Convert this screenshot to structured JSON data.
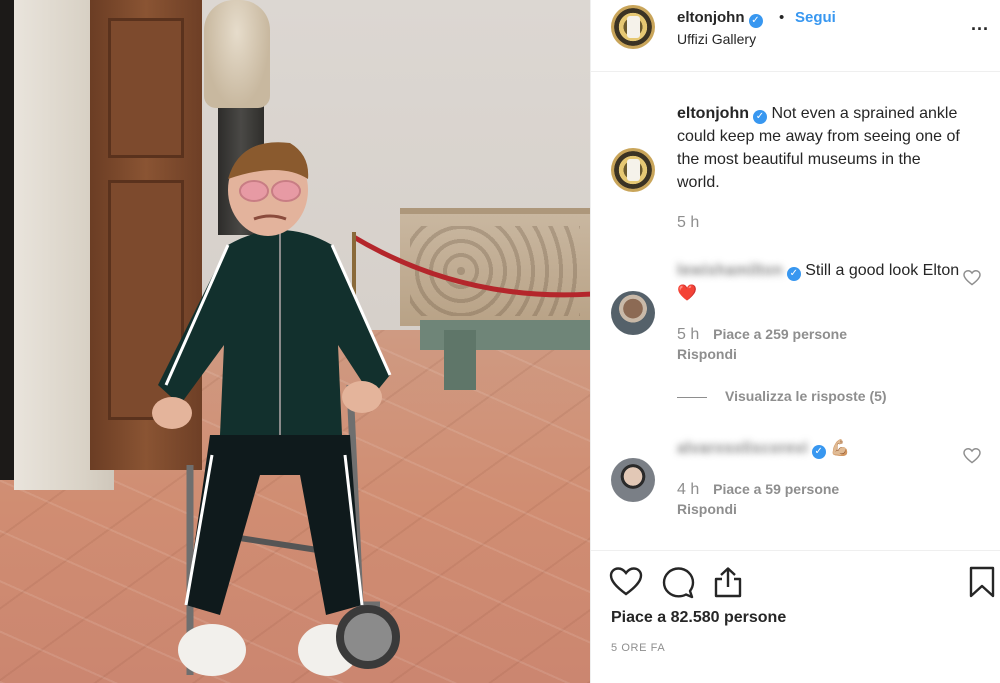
{
  "header": {
    "username": "eltonjohn",
    "separator": "•",
    "follow_label": "Segui",
    "location": "Uffizi Gallery",
    "more_label": "..."
  },
  "caption": {
    "username": "eltonjohn",
    "text": "Not even a sprained ankle could keep me away from seeing one of the most beautiful museums in the world.",
    "time": "5 h"
  },
  "comments": [
    {
      "username": "lewishamilton",
      "text": "Still a good look Elton",
      "emoji": "❤️",
      "time": "5 h",
      "likes": "Piace a 259 persone",
      "reply_label": "Rispondi"
    },
    {
      "username": "alvarosoliscorevi",
      "text": "",
      "emoji": "💪🏼",
      "time": "4 h",
      "likes": "Piace a 59 persone",
      "reply_label": "Rispondi"
    }
  ],
  "view_replies_label": "Visualizza le risposte (5)",
  "footer": {
    "likes_label": "Piace a 82.580 persone",
    "posted_ago": "5 ORE FA"
  },
  "icons": {
    "verified": "verified-badge-icon",
    "heart": "heart-icon",
    "comment": "comment-icon",
    "share": "share-icon",
    "bookmark": "bookmark-icon"
  },
  "colors": {
    "link_blue": "#3897f0",
    "verified_blue": "#3897f0",
    "muted_text": "#8e8e8e",
    "text": "#262626",
    "heart_red": "#e0245e"
  }
}
